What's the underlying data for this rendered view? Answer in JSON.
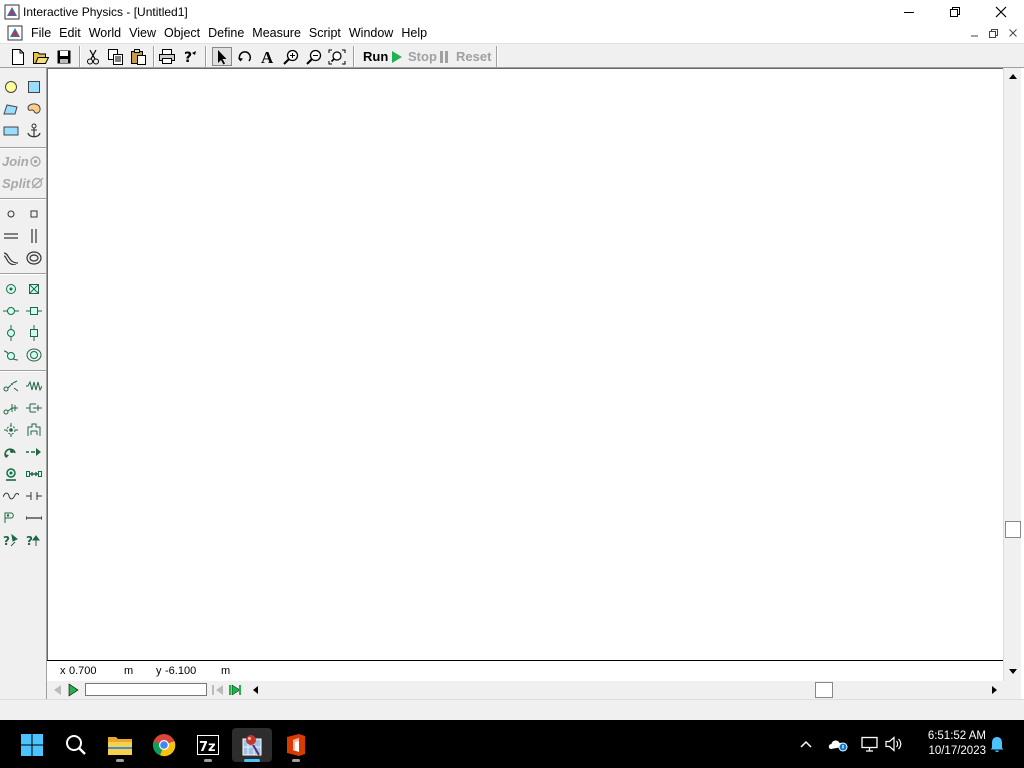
{
  "window": {
    "title": "Interactive Physics - [Untitled1]",
    "buttons": {
      "minimize": "minimize-icon",
      "restore": "restore-icon",
      "close": "close-icon"
    }
  },
  "menubar": {
    "items": [
      "File",
      "Edit",
      "World",
      "View",
      "Object",
      "Define",
      "Measure",
      "Script",
      "Window",
      "Help"
    ]
  },
  "toolbar": {
    "run_label": "Run",
    "stop_label": "Stop",
    "reset_label": "Reset",
    "icons": [
      "new-icon",
      "open-icon",
      "save-icon",
      "cut-icon",
      "copy-icon",
      "paste-icon",
      "print-icon",
      "help-icon",
      "arrow-icon",
      "rotate-icon",
      "text-icon",
      "zoom-in-icon",
      "zoom-out-icon",
      "zoom-fit-icon"
    ]
  },
  "palette": {
    "join_label": "Join",
    "split_label": "Split"
  },
  "coords": {
    "x_label": "x",
    "x_value": "0.700",
    "x_unit": "m",
    "y_label": "y",
    "y_value": "-6.100",
    "y_unit": "m"
  },
  "taskbar": {
    "apps": [
      "start-icon",
      "search-icon",
      "file-explorer-icon",
      "chrome-icon",
      "7zip-icon",
      "interactive-physics-icon",
      "office-icon"
    ],
    "time": "6:51:52 AM",
    "date": "10/17/2023"
  },
  "colors": {
    "run_green": "#22b14c",
    "canvas": "#ffffff",
    "chrome": "#f0f0f0",
    "taskbar": "#000000",
    "active_indicator": "#4cc2ff"
  }
}
